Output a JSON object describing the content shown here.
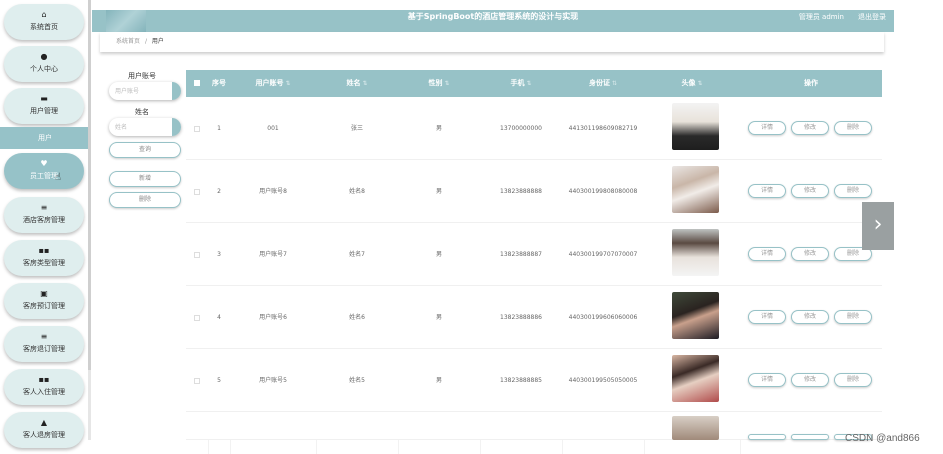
{
  "header": {
    "title": "基于SpringBoot的酒店管理系统的设计与实现",
    "user": "管理员 admin",
    "logout": "退出登录"
  },
  "breadcrumb": {
    "home": "系统首页",
    "separator": "/",
    "current": "用户"
  },
  "sidebar": {
    "items": [
      {
        "icon": "home-icon",
        "glyph": "⌂",
        "label": "系统首页"
      },
      {
        "icon": "user-icon",
        "glyph": "●",
        "label": "个人中心"
      },
      {
        "icon": "users-icon",
        "glyph": "▬",
        "label": "用户管理"
      },
      {
        "icon": "heart-icon",
        "glyph": "♥",
        "label": "员工管理"
      },
      {
        "icon": "list-icon",
        "glyph": "≡",
        "label": "酒店客房管理"
      },
      {
        "icon": "grid-icon",
        "glyph": "▪▪",
        "label": "客房类型管理"
      },
      {
        "icon": "bag-icon",
        "glyph": "▣",
        "label": "客房预订管理"
      },
      {
        "icon": "list2-icon",
        "glyph": "≡",
        "label": "客房退订管理"
      },
      {
        "icon": "grid2-icon",
        "glyph": "▪▪",
        "label": "客人入住管理"
      },
      {
        "icon": "thumb-icon",
        "glyph": "▲",
        "label": "客人退房管理"
      }
    ],
    "submenu": "用户"
  },
  "search": {
    "field1_label": "用户账号",
    "field1_placeholder": "用户账号",
    "field2_label": "姓名",
    "field2_placeholder": "姓名",
    "query_button": "查询",
    "add_button": "新增",
    "delete_button": "删除"
  },
  "table": {
    "headers": {
      "index": "序号",
      "account": "用户账号",
      "name": "姓名",
      "gender": "性别",
      "phone": "手机",
      "idcard": "身份证",
      "avatar": "头像",
      "ops": "操作"
    },
    "rows": [
      {
        "index": "1",
        "account": "001",
        "name": "张三",
        "gender": "男",
        "phone": "13700000000",
        "idcard": "441301198609082719"
      },
      {
        "index": "2",
        "account": "用户账号8",
        "name": "姓名8",
        "gender": "男",
        "phone": "13823888888",
        "idcard": "440300199808080008"
      },
      {
        "index": "3",
        "account": "用户账号7",
        "name": "姓名7",
        "gender": "男",
        "phone": "13823888887",
        "idcard": "440300199707070007"
      },
      {
        "index": "4",
        "account": "用户账号6",
        "name": "姓名6",
        "gender": "男",
        "phone": "13823888886",
        "idcard": "440300199606060006"
      },
      {
        "index": "5",
        "account": "用户账号5",
        "name": "姓名5",
        "gender": "男",
        "phone": "13823888885",
        "idcard": "440300199505050005"
      }
    ],
    "op_detail": "详情",
    "op_edit": "修改",
    "op_delete": "删除"
  },
  "carousel": {
    "arrow": "›"
  },
  "watermark": "CSDN @and866",
  "colors": {
    "accent": "#97c2c7",
    "sidebar_bg": "#dfeeee"
  }
}
